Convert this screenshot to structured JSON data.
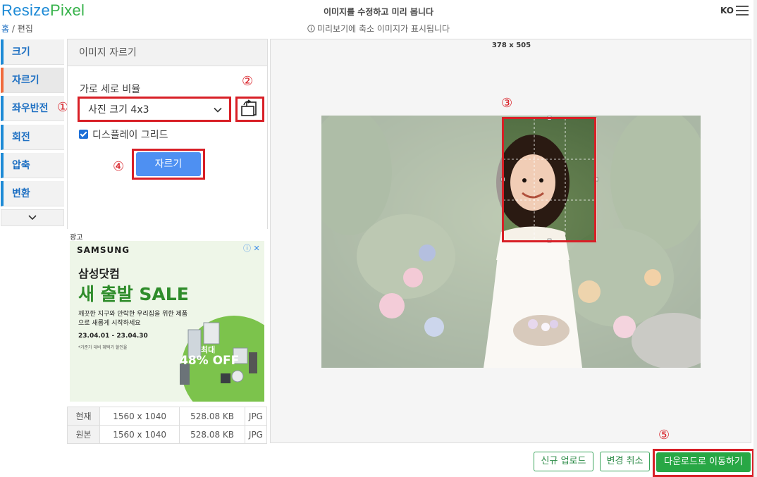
{
  "header": {
    "logo_resize": "Resize",
    "logo_pixel": "Pixel",
    "breadcrumb_home": "홈",
    "breadcrumb_sep": " / ",
    "breadcrumb_current": "편집",
    "title": "이미지를 수정하고 미리 봅니다",
    "subtitle": "미리보기에 축소 이미지가 표시됩니다",
    "language": "KO"
  },
  "sidebar": {
    "items": [
      {
        "label": "크기"
      },
      {
        "label": "자르기"
      },
      {
        "label": "좌우반전"
      },
      {
        "label": "회전"
      },
      {
        "label": "압축"
      },
      {
        "label": "변환"
      }
    ],
    "active": "자르기"
  },
  "crop_panel": {
    "title": "이미지 자르기",
    "ratio_label": "가로 세로 비율",
    "ratio_value": "사진 크기 4x3",
    "grid_label": "디스플레이 그리드",
    "grid_checked": true,
    "crop_button": "자르기"
  },
  "annotations": [
    "①",
    "②",
    "③",
    "④",
    "⑤"
  ],
  "ad": {
    "label": "광고",
    "brand": "SAMSUNG",
    "line1": "삼성닷컴",
    "line2": "새 출발 SALE",
    "body": "깨끗한 지구와 안락한 우리집을 위한 제품으로 새롭게 시작하세요",
    "date": "23.04.01 - 23.04.30",
    "note": "*가준가 대비 혜택가 할인율",
    "offer_small": "최대",
    "offer": "48% OFF"
  },
  "info_table": {
    "rows": [
      {
        "label": "현재",
        "dims": "1560 x 1040",
        "size": "528.08 KB",
        "format": "JPG"
      },
      {
        "label": "원본",
        "dims": "1560 x 1040",
        "size": "528.08 KB",
        "format": "JPG"
      }
    ]
  },
  "preview": {
    "dimensions": "378 x 505"
  },
  "footer": {
    "new_upload": "신규 업로드",
    "cancel_changes": "변경 취소",
    "download": "다운로드로 이동하기"
  },
  "colors": {
    "brand_blue": "#1d8ad6",
    "brand_green": "#36b24a",
    "annotation_red": "#d81f26",
    "crop_button": "#4e90f2",
    "download_green": "#28a745"
  }
}
